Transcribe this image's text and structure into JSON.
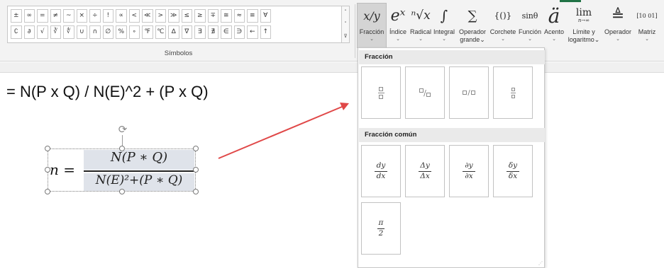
{
  "ribbon": {
    "symbols_row1": [
      "±",
      "∞",
      "=",
      "≠",
      "~",
      "×",
      "÷",
      "!",
      "∝",
      "<",
      "≪",
      ">",
      "≫",
      "≤",
      "≥",
      "∓",
      "≅",
      "≈",
      "≡",
      "∀"
    ],
    "symbols_row2": [
      "∁",
      "∂",
      "√",
      "∛",
      "∜",
      "∪",
      "∩",
      "∅",
      "%",
      "∘",
      "℉",
      "℃",
      "∆",
      "∇",
      "∃",
      "∄",
      "∈",
      "∋",
      "←",
      "↑"
    ],
    "gallery_scroll": [
      "˄",
      "˅",
      "⊽"
    ],
    "group_label": "Símbolos",
    "structures": [
      {
        "glyph": "x/y",
        "label": "Fracción"
      },
      {
        "glyph": "eˣ",
        "label": "Índice"
      },
      {
        "glyph": "ⁿ√x",
        "label": "Radical"
      },
      {
        "glyph": "∫",
        "label": "Integral"
      },
      {
        "glyph": "∑",
        "label": "Operador",
        "label2": "grande"
      },
      {
        "glyph": "{()}",
        "label": "Corchete"
      },
      {
        "glyph": "sinθ",
        "label": "Función"
      },
      {
        "glyph": "ä",
        "label": "Acento"
      },
      {
        "glyph": "lim",
        "sub": "n→∞",
        "label": "Límite y",
        "label2": "logaritmo"
      },
      {
        "glyph": "≜",
        "label": "Operador"
      },
      {
        "glyph": "[10 01]",
        "label": "Matriz"
      }
    ],
    "chevron": "⌄",
    "accent_color": "#217346"
  },
  "sheet": {
    "formula_text": "=  N(P x Q) / N(E)^2 + (P x Q)"
  },
  "equation": {
    "lhs": "n =",
    "numerator": "N(P ∗ Q)",
    "denominator": "N(E)²+(P ∗ Q)",
    "rotate_glyph": "⟳"
  },
  "arrow": {
    "color": "#e04848"
  },
  "panel": {
    "section1_title": "Fracción",
    "section2_title": "Fracción común",
    "common_fractions": [
      {
        "num": "dy",
        "den": "dx"
      },
      {
        "num": "Δy",
        "den": "Δx"
      },
      {
        "num": "∂y",
        "den": "∂x"
      },
      {
        "num": "δy",
        "den": "δx"
      },
      {
        "num": "π",
        "den": "2"
      }
    ],
    "linear_slash": "/",
    "grip": "⋰"
  }
}
